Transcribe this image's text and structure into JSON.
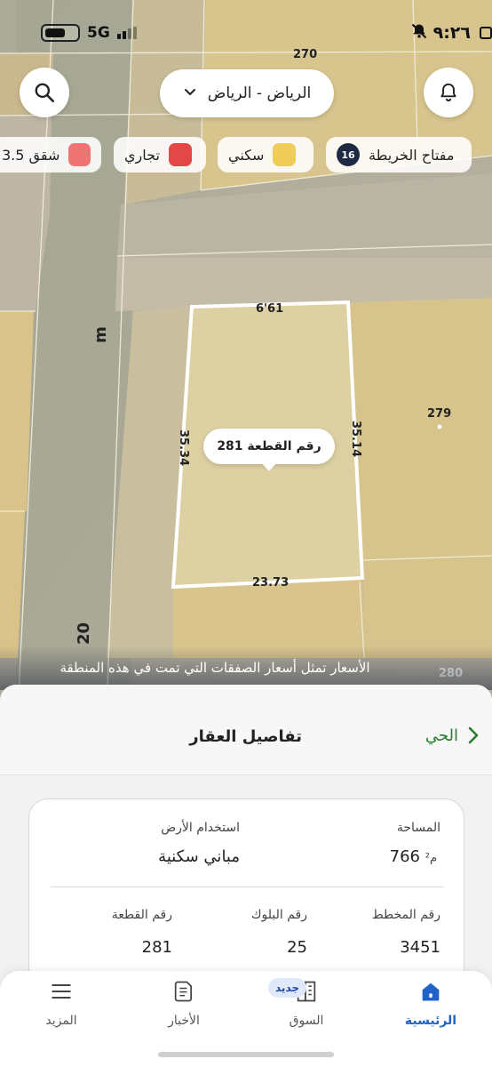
{
  "status_bar": {
    "time": "٩:٢٦",
    "network": "5G"
  },
  "map": {
    "city_selector": "الرياض - الرياض",
    "legend": {
      "key_label": "مفتاح الخريطة",
      "count": "16",
      "items": [
        {
          "label": "سكني",
          "color": "#f0cd5a"
        },
        {
          "label": "تجاري",
          "color": "#e34848"
        },
        {
          "label": "شقق 3.5",
          "color": "#f07474"
        }
      ]
    },
    "plot_bubble": "رقم القطعة 281",
    "dimensions": {
      "top": "6'61",
      "right": "35.14",
      "left": "35.34",
      "bottom": "23.73"
    },
    "neighbor_numbers": {
      "top": "270",
      "right": "279",
      "bottom": "280"
    },
    "street_labels": {
      "street_m": "m",
      "street_20": "20"
    },
    "price_note": "الأسعار تمثل أسعار الصفقات التي تمت في هذه المنطقة"
  },
  "sheet": {
    "title": "تفاصيل العقار",
    "district_link": "الحي",
    "area_label": "المساحة",
    "area_value": "766",
    "area_unit": "م²",
    "land_use_label": "استخدام الأرض",
    "land_use_value": "مباني سكنية",
    "plan_label": "رقم المخطط",
    "plan_value": "3451",
    "block_label": "رقم البلوك",
    "block_value": "25",
    "plot_label": "رقم القطعة",
    "plot_value": "281"
  },
  "tabbar": {
    "tabs": [
      {
        "label": "الرئيسية",
        "active": true
      },
      {
        "label": "السوق"
      },
      {
        "label": "الأخبار"
      },
      {
        "label": "المزيد"
      }
    ],
    "new_badge": "جديد"
  }
}
